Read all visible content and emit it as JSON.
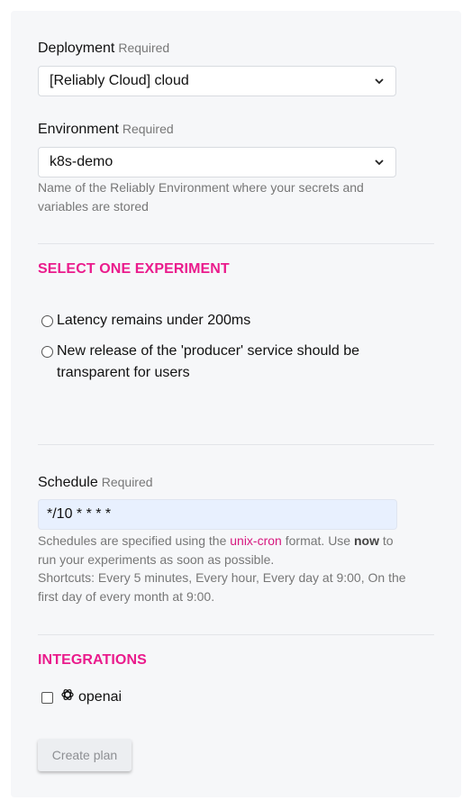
{
  "deployment": {
    "label": "Deployment",
    "required": "Required",
    "value": "[Reliably Cloud] cloud"
  },
  "environment": {
    "label": "Environment",
    "required": "Required",
    "value": "k8s-demo",
    "help": "Name of the Reliably Environment where your secrets and variables are stored"
  },
  "experiments": {
    "title": "SELECT ONE EXPERIMENT",
    "options": [
      {
        "label": "Latency remains under 200ms"
      },
      {
        "label_line1": "New release of the 'producer' service should be",
        "label_line2": "transparent for users"
      }
    ]
  },
  "schedule": {
    "label": "Schedule",
    "required": "Required",
    "value": "*/10 * * * *",
    "help_prefix": "Schedules are specified using the ",
    "help_link": "unix-cron",
    "help_mid": " format. Use ",
    "help_bold": "now",
    "help_suffix": " to run your experiments as soon as possible.",
    "shortcuts": "Shortcuts: Every 5 minutes, Every hour, Every day at 9:00, On the first day of every month at 9:00."
  },
  "integrations": {
    "title": "INTEGRATIONS",
    "items": [
      {
        "label": "openai",
        "icon": "openai-icon"
      }
    ]
  },
  "actions": {
    "create_plan": "Create plan"
  }
}
